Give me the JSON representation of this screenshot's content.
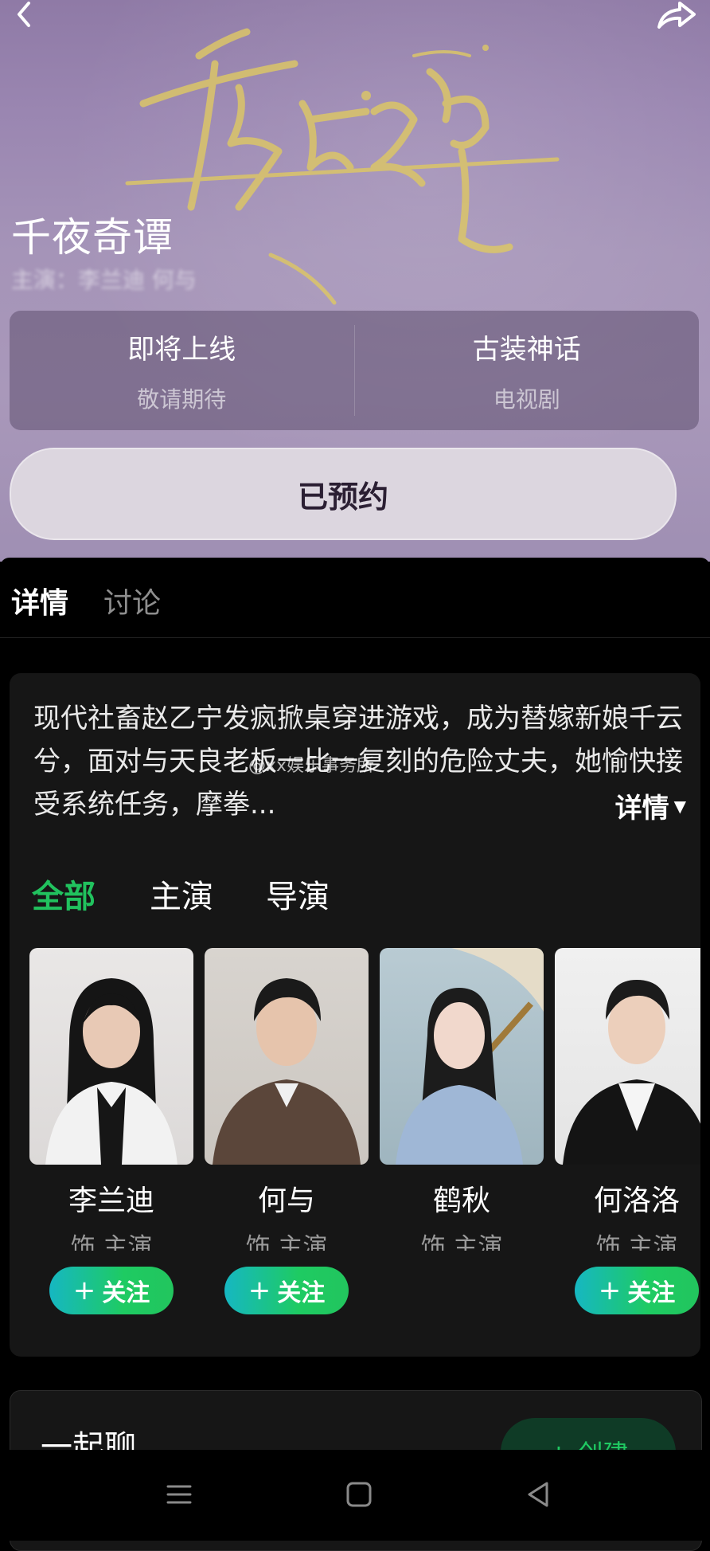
{
  "header": {
    "back_icon": "chevron-left-icon",
    "share_icon": "share-arrow-icon",
    "title": "千夜奇谭",
    "subtitle": "主演：李兰迪 何与"
  },
  "info": {
    "status_main": "即将上线",
    "status_sub": "敬请期待",
    "genre_main": "古装神话",
    "genre_sub": "电视剧"
  },
  "reserve_button": "已预约",
  "tabs": [
    {
      "label": "详情",
      "active": true
    },
    {
      "label": "讨论",
      "active": false
    }
  ],
  "synopsis": "现代社畜赵乙宁发疯掀桌穿进游戏，成为替嫁新娘千云兮，面对与天良老板一比一复刻的危险丈夫，她愉快接受系统任务，摩拳...",
  "more_label": "详情",
  "watermark": "@xx娱乐事务所",
  "filters": [
    "全部",
    "主演",
    "导演"
  ],
  "cast": [
    {
      "name": "李兰迪",
      "role": "饰 主演",
      "follow": "关注",
      "show_follow": true
    },
    {
      "name": "何与",
      "role": "饰 主演",
      "follow": "关注",
      "show_follow": true
    },
    {
      "name": "鹤秋",
      "role": "饰 主演",
      "follow": "",
      "show_follow": false
    },
    {
      "name": "何洛洛",
      "role": "饰 主演",
      "follow": "关注",
      "show_follow": true
    }
  ],
  "chat": {
    "title": "一起聊",
    "button": "+ 创建"
  },
  "colors": {
    "accent_green": "#21c25e",
    "hero_purple": "#a594b8",
    "panel_bg": "#161616"
  }
}
